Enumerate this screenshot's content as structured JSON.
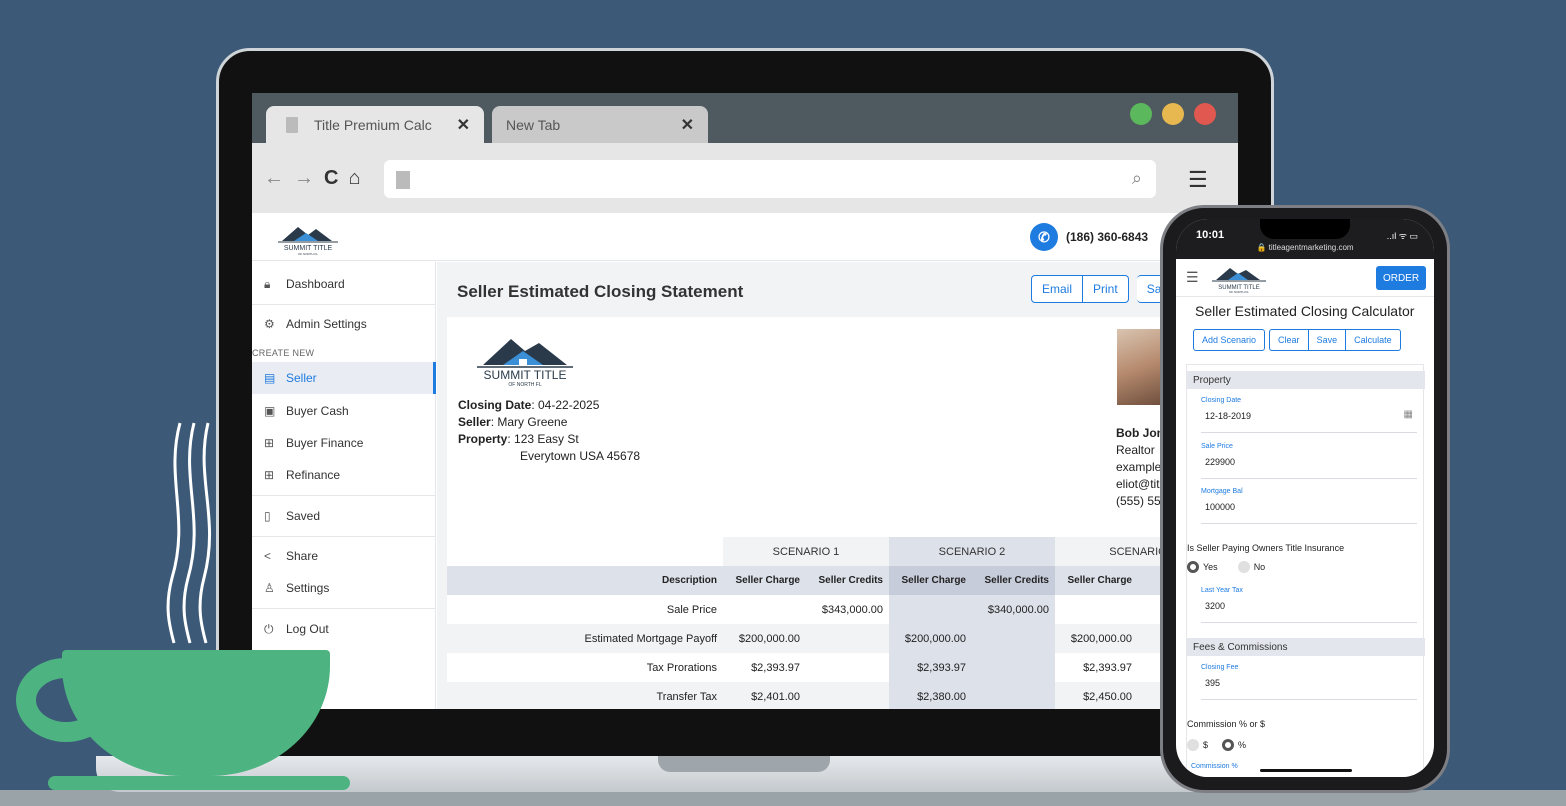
{
  "browser": {
    "tabs": [
      {
        "label": "Title Premium Calc",
        "close": "✕"
      },
      {
        "label": "New Tab",
        "close": "✕"
      }
    ],
    "nav_icons": {
      "back": "←",
      "forward": "→",
      "reload": "C",
      "home": "⌂"
    },
    "menu_icon": "☰",
    "search_icon": "⌕"
  },
  "app": {
    "brand": "SUMMIT TITLE",
    "brand_sub": "OF NORTH FL",
    "phone": "(186) 360-6843",
    "sidebar": {
      "items": [
        {
          "label": "Dashboard",
          "icon": "🔒︎"
        },
        {
          "label": "Admin Settings",
          "icon": "⚙"
        },
        {
          "label": "Seller",
          "icon": "▤"
        },
        {
          "label": "Buyer Cash",
          "icon": "▣"
        },
        {
          "label": "Buyer Finance",
          "icon": "⊞"
        },
        {
          "label": "Refinance",
          "icon": "⊞"
        },
        {
          "label": "Saved",
          "icon": "▯"
        },
        {
          "label": "Share",
          "icon": "<"
        },
        {
          "label": "Settings",
          "icon": "♙"
        },
        {
          "label": "Log Out",
          "icon": "⏻"
        }
      ],
      "section_label": "CREATE NEW"
    },
    "page_title": "Seller Estimated Closing Statement",
    "buttons": {
      "email": "Email",
      "print": "Print",
      "save": "Sa"
    },
    "statement": {
      "closing_date_label": "Closing Date",
      "closing_date": ": 04-22-2025",
      "seller_label": "Seller",
      "seller": ": Mary Greene",
      "property_label": "Property",
      "property_line1": ": 123 Easy St",
      "property_line2": "Everytown USA 45678"
    },
    "agent": {
      "name": "Bob Jon",
      "title": "Realtor",
      "line3": "example",
      "email": "eliot@tit",
      "phone": "(555) 555"
    },
    "table": {
      "scenarios": [
        "SCENARIO 1",
        "SCENARIO 2",
        "SCENARIO"
      ],
      "headers": [
        "Description",
        "Seller Charge",
        "Seller Credits",
        "Seller Charge",
        "Seller Credits",
        "Seller Charge",
        "S"
      ],
      "rows": [
        [
          "Sale Price",
          "",
          "$343,000.00",
          "",
          "$340,000.00",
          "",
          "$"
        ],
        [
          "Estimated Mortgage Payoff",
          "$200,000.00",
          "",
          "$200,000.00",
          "",
          "$200,000.00",
          ""
        ],
        [
          "Tax Prorations",
          "$2,393.97",
          "",
          "$2,393.97",
          "",
          "$2,393.97",
          ""
        ],
        [
          "Transfer Tax",
          "$2,401.00",
          "",
          "$2,380.00",
          "",
          "$2,450.00",
          ""
        ]
      ]
    }
  },
  "phone_ui": {
    "time": "10:01",
    "url": "🔒 titleagentmarketing.com",
    "signal": "..ıl ᯤ ▭",
    "order_button": "ORDER",
    "title": "Seller Estimated Closing Calculator",
    "buttons": [
      "Add Scenario",
      "Clear",
      "Save",
      "Calculate"
    ],
    "sections": {
      "property": "Property",
      "fees": "Fees & Commissions"
    },
    "fields": [
      {
        "label": "Closing Date",
        "value": "12-18-2019"
      },
      {
        "label": "Sale Price",
        "value": "229900"
      },
      {
        "label": "Mortgage Bal",
        "value": "100000"
      },
      {
        "label": "Last Year Tax",
        "value": "3200"
      },
      {
        "label": "Closing Fee",
        "value": "395"
      }
    ],
    "owners_title_question": "Is Seller Paying Owners Title Insurance",
    "yes": "Yes",
    "no": "No",
    "commission_question": "Commission % or $",
    "dollar": "$",
    "percent": "%",
    "commission_label": "Commission %"
  }
}
